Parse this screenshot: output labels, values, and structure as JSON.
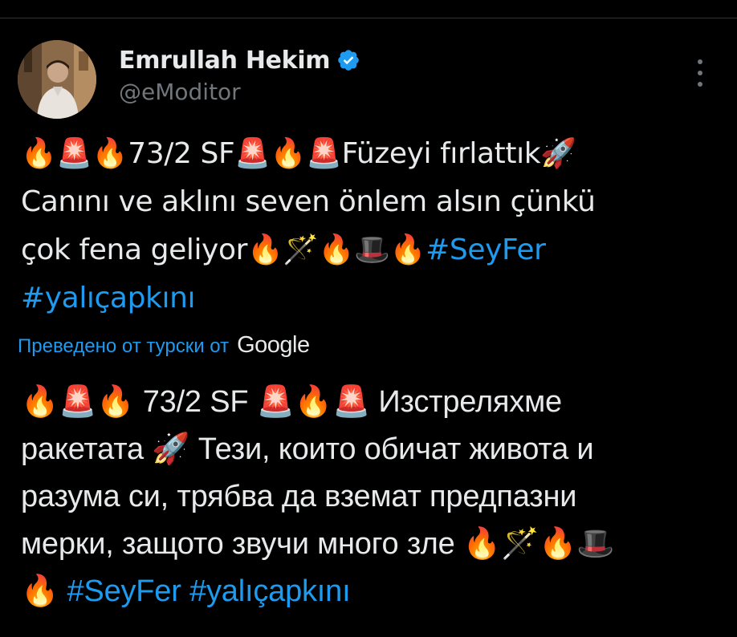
{
  "author": {
    "display_name": "Emrullah Hekim",
    "handle": "@eModitor",
    "verified": true
  },
  "tweet": {
    "line1": "🔥🚨🔥73/2 SF🚨🔥🚨Füzeyi fırlattık🚀",
    "line2": "Canını ve aklını seven önlem alsın çünkü",
    "line3": "çok fena geliyor🔥🪄🔥🎩🔥",
    "hashtag1": "#SeyFer",
    "hashtag2": "#yalıçapkını"
  },
  "translation": {
    "label": "Преведено от турски от",
    "provider": "Google",
    "line1": "🔥🚨🔥 73/2 SF 🚨🔥🚨 Изстреляхме",
    "line2": "ракетата 🚀 Тези, които обичат живота и",
    "line3": "разума си, трябва да вземат предпазни",
    "line4": "мерки, защото звучи много зле 🔥🪄🔥🎩",
    "line5": "🔥",
    "hashtag1": "#SeyFer",
    "hashtag2": "#yalıçapkını"
  },
  "colors": {
    "background": "#000000",
    "text": "#e7e9ea",
    "secondary": "#71767b",
    "accent": "#1d9bf0"
  },
  "icons": {
    "verified": "verified-badge-icon",
    "more": "more-options-icon"
  }
}
